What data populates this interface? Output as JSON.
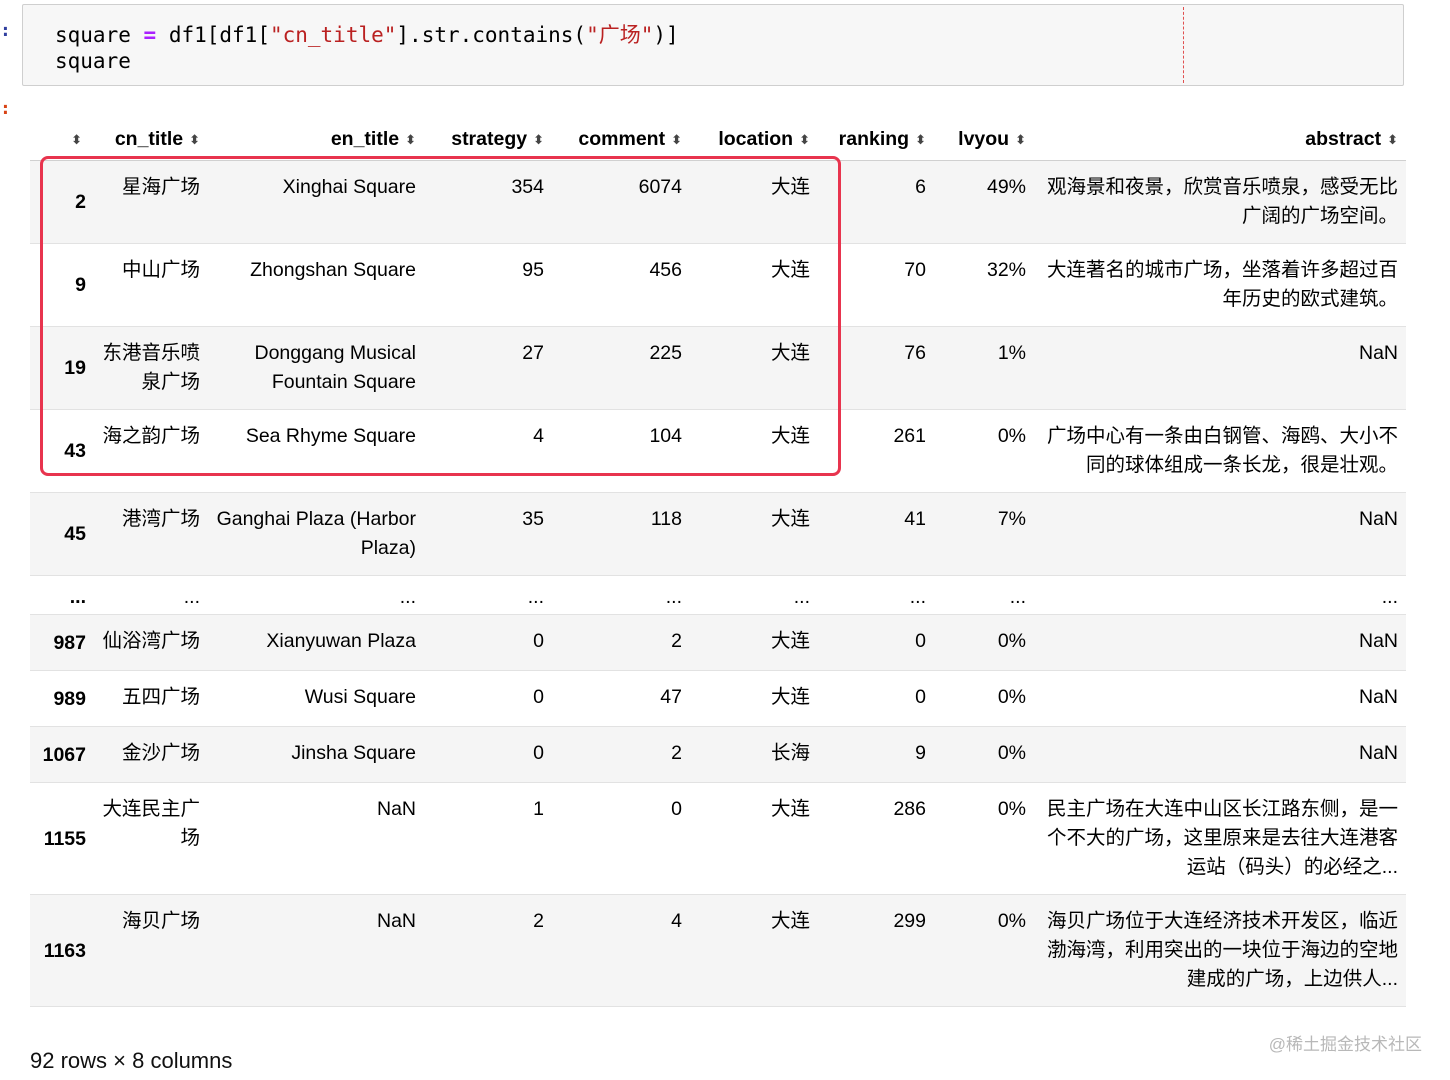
{
  "code": {
    "line1": {
      "var": "square ",
      "op": "=",
      "pre": " df1[df1[",
      "str1": "\"cn_title\"",
      "mid": "].str.contains(",
      "str2": "\"广场\"",
      "post": ")]"
    },
    "line2": "square"
  },
  "prompt_markers": {
    "input": ":",
    "output": ":"
  },
  "table": {
    "columns": [
      "cn_title",
      "en_title",
      "strategy",
      "comment",
      "location",
      "ranking",
      "lvyou",
      "abstract"
    ],
    "sort_icon": "sort-arrows-icon",
    "rows": [
      {
        "index": "2",
        "cn_title": "星海广场",
        "en_title": "Xinghai Square",
        "strategy": "354",
        "comment": "6074",
        "location": "大连",
        "ranking": "6",
        "lvyou": "49%",
        "abstract": "观海景和夜景，欣赏音乐喷泉，感受无比广阔的广场空间。"
      },
      {
        "index": "9",
        "cn_title": "中山广场",
        "en_title": "Zhongshan Square",
        "strategy": "95",
        "comment": "456",
        "location": "大连",
        "ranking": "70",
        "lvyou": "32%",
        "abstract": "大连著名的城市广场，坐落着许多超过百年历史的欧式建筑。"
      },
      {
        "index": "19",
        "cn_title": "东港音乐喷泉广场",
        "en_title": "Donggang Musical Fountain Square",
        "strategy": "27",
        "comment": "225",
        "location": "大连",
        "ranking": "76",
        "lvyou": "1%",
        "abstract": "NaN"
      },
      {
        "index": "43",
        "cn_title": "海之韵广场",
        "en_title": "Sea Rhyme Square",
        "strategy": "4",
        "comment": "104",
        "location": "大连",
        "ranking": "261",
        "lvyou": "0%",
        "abstract": "广场中心有一条由白钢管、海鸥、大小不同的球体组成一条长龙，很是壮观。"
      },
      {
        "index": "45",
        "cn_title": "港湾广场",
        "en_title": "Ganghai Plaza (Harbor Plaza)",
        "strategy": "35",
        "comment": "118",
        "location": "大连",
        "ranking": "41",
        "lvyou": "7%",
        "abstract": "NaN"
      },
      {
        "index": "...",
        "cn_title": "...",
        "en_title": "...",
        "strategy": "...",
        "comment": "...",
        "location": "...",
        "ranking": "...",
        "lvyou": "...",
        "abstract": "..."
      },
      {
        "index": "987",
        "cn_title": "仙浴湾广场",
        "en_title": "Xianyuwan Plaza",
        "strategy": "0",
        "comment": "2",
        "location": "大连",
        "ranking": "0",
        "lvyou": "0%",
        "abstract": "NaN"
      },
      {
        "index": "989",
        "cn_title": "五四广场",
        "en_title": "Wusi Square",
        "strategy": "0",
        "comment": "47",
        "location": "大连",
        "ranking": "0",
        "lvyou": "0%",
        "abstract": "NaN"
      },
      {
        "index": "1067",
        "cn_title": "金沙广场",
        "en_title": "Jinsha Square",
        "strategy": "0",
        "comment": "2",
        "location": "长海",
        "ranking": "9",
        "lvyou": "0%",
        "abstract": "NaN"
      },
      {
        "index": "1155",
        "cn_title": "大连民主广场",
        "en_title": "NaN",
        "strategy": "1",
        "comment": "0",
        "location": "大连",
        "ranking": "286",
        "lvyou": "0%",
        "abstract": "民主广场在大连中山区长江路东侧，是一个不大的广场，这里原来是去往大连港客运站（码头）的必经之..."
      },
      {
        "index": "1163",
        "cn_title": "海贝广场",
        "en_title": "NaN",
        "strategy": "2",
        "comment": "4",
        "location": "大连",
        "ranking": "299",
        "lvyou": "0%",
        "abstract": "海贝广场位于大连经济技术开发区，临近渤海湾，利用突出的一块位于海边的空地建成的广场，上边供人..."
      }
    ]
  },
  "shape_info": "92 rows × 8 columns",
  "watermark": "@稀土掘金技术社区",
  "colors": {
    "highlight": "#e8344e",
    "keyword_op": "#aa22ff",
    "string": "#ba2121"
  }
}
